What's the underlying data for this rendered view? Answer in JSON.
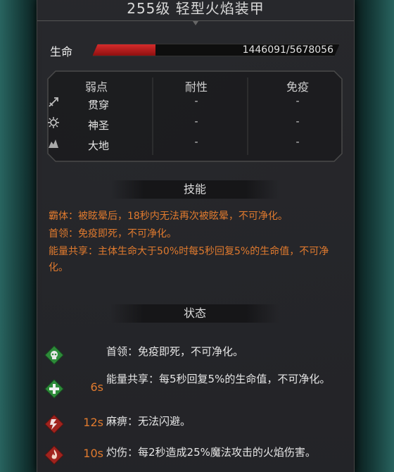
{
  "header": {
    "title": "255级  轻型火焰装甲"
  },
  "hp": {
    "label": "生命",
    "value": "1446091/5678056",
    "fraction": 0.255
  },
  "resistances": {
    "headers": [
      "弱点",
      "耐性",
      "免疫"
    ],
    "rows": [
      {
        "name": "贯穿",
        "icon": "pierce-icon",
        "tough": "-",
        "immune": "-"
      },
      {
        "name": "神圣",
        "icon": "holy-icon",
        "tough": "-",
        "immune": "-"
      },
      {
        "name": "大地",
        "icon": "earth-icon",
        "tough": "-",
        "immune": "-"
      }
    ]
  },
  "skills": {
    "title": "技能",
    "items": [
      "霸体：被眩晕后，18秒内无法再次被眩晕，不可净化。",
      "首领：免疫即死，不可净化。",
      "能量共享：主体生命大于50%时每5秒回复5%的生命值，不可净化。"
    ]
  },
  "status": {
    "title": "状态",
    "items": [
      {
        "icon": "boss-skull-icon",
        "time": "",
        "text": "首领：免疫即死，不可净化。",
        "color": "#2e8b3a"
      },
      {
        "icon": "heal-plus-icon",
        "time": "6s",
        "text": "能量共享：每5秒回复5%的生命值，不可净化。",
        "color": "#2e8b3a"
      },
      {
        "icon": "paralysis-icon",
        "time": "12s",
        "text": "麻痹：无法闪避。",
        "color": "#a0231e"
      },
      {
        "icon": "burn-icon",
        "time": "10s",
        "text": "灼伤：每2秒造成25%魔法攻击的火焰伤害。",
        "color": "#a0231e"
      }
    ]
  },
  "colors": {
    "accent": "#e07a2e",
    "hp_red": "#d52b2b",
    "panel": "#28282c"
  }
}
